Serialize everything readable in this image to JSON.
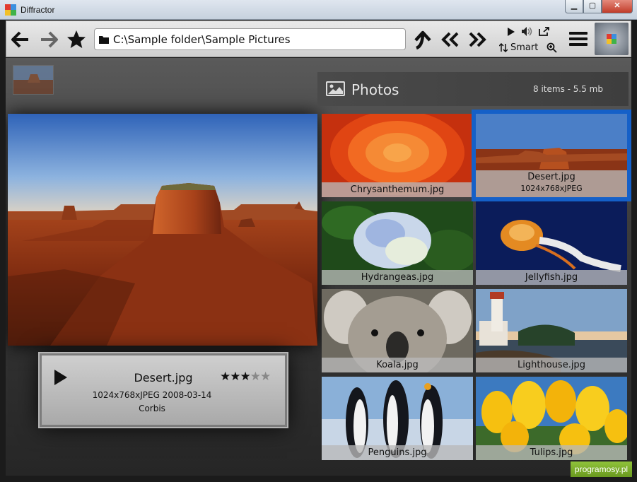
{
  "window": {
    "title": "Diffractor",
    "minimize": "▁",
    "maximize": "▢",
    "close": "✕"
  },
  "toolbar": {
    "path": "C:\\Sample folder\\Sample Pictures",
    "sort_label": "Smart",
    "icons": [
      "back-arrow-icon",
      "forward-arrow-icon",
      "favorite-star-icon",
      "folder-icon",
      "up-arrow-icon",
      "previous-icon",
      "next-icon",
      "play-icon",
      "volume-icon",
      "fullscreen-icon",
      "sort-icon",
      "zoom-icon",
      "menu-icon"
    ]
  },
  "preview": {
    "file_name": "Desert.jpg",
    "meta": "1024x768xJPEG 2008-03-14",
    "author": "Corbis",
    "rating": 3,
    "rating_max": 5
  },
  "photos": {
    "title": "Photos",
    "summary": "8 items - 5.5 mb",
    "items": [
      {
        "name": "Chrysanthemum.jpg"
      },
      {
        "name": "Desert.jpg",
        "detail": "1024x768xJPEG",
        "selected": true
      },
      {
        "name": "Hydrangeas.jpg"
      },
      {
        "name": "Jellyfish.jpg"
      },
      {
        "name": "Koala.jpg"
      },
      {
        "name": "Lighthouse.jpg"
      },
      {
        "name": "Penguins.jpg"
      },
      {
        "name": "Tulips.jpg"
      }
    ]
  },
  "watermark": "programosy.pl",
  "colors": {
    "selection": "#1560c8",
    "panel": "#bdbdbd",
    "background": "#2e2e2e"
  }
}
